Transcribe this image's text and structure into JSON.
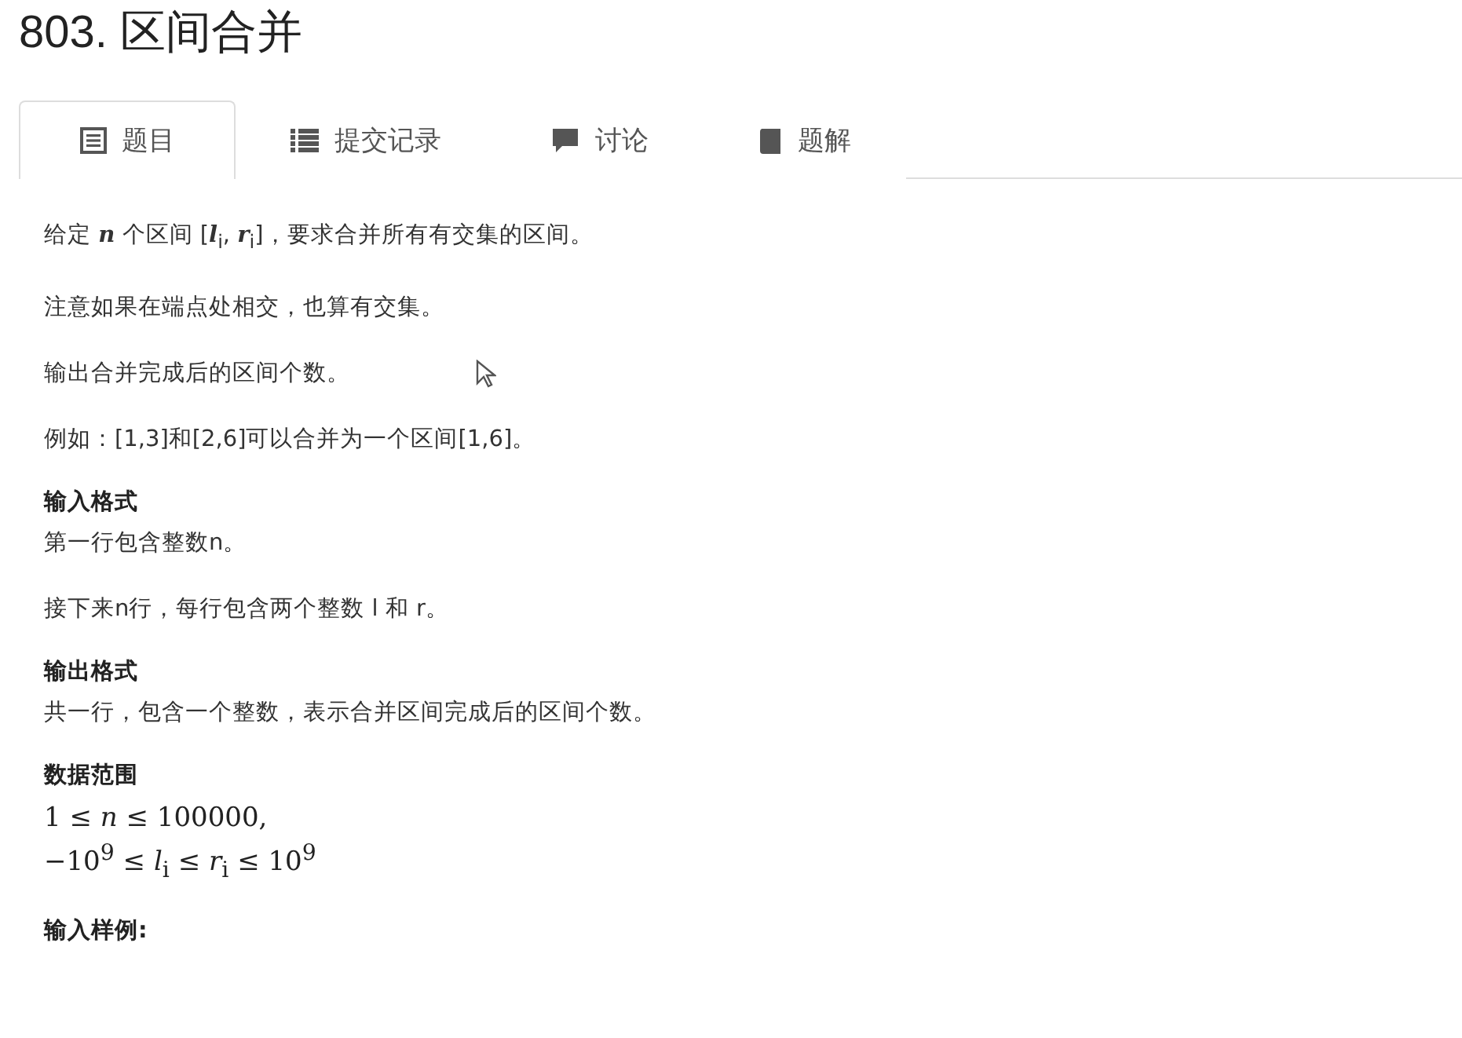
{
  "title": "803. 区间合并",
  "tabs": [
    {
      "label": "题目",
      "selected": true
    },
    {
      "label": "提交记录",
      "selected": false
    },
    {
      "label": "讨论",
      "selected": false
    },
    {
      "label": "题解",
      "selected": false
    }
  ],
  "content": [
    {
      "kind": "paragraph",
      "text": "给定 *n* 个区间 [*l*$_{i}$, *r*$_{i}$]，要求合并所有有交集的区间。"
    },
    {
      "kind": "paragraph",
      "text": "注意如果在端点处相交，也算有交集。"
    },
    {
      "kind": "paragraph",
      "text": "输出合并完成后的区间个数。",
      "cursor": true
    },
    {
      "kind": "paragraph",
      "text": "例如：[1,3]和[2,6]可以合并为一个区间[1,6]。"
    },
    {
      "kind": "heading",
      "text": "输入格式"
    },
    {
      "kind": "paragraph",
      "text": "第一行包含整数n。"
    },
    {
      "kind": "paragraph",
      "text": "接下来n行，每行包含两个整数 l 和 r。"
    },
    {
      "kind": "heading",
      "text": "输出格式"
    },
    {
      "kind": "paragraph",
      "text": "共一行，包含一个整数，表示合并区间完成后的区间个数。"
    },
    {
      "kind": "heading",
      "text": "数据范围"
    },
    {
      "kind": "math",
      "lines": [
        "1 ≤ *n* ≤ 100000,",
        "−10$^{9}$ ≤ *l*$_{i}$ ≤ *r*$_{i}$ ≤ 10$^{9}$"
      ]
    },
    {
      "kind": "heading",
      "text": "输入样例:"
    }
  ]
}
